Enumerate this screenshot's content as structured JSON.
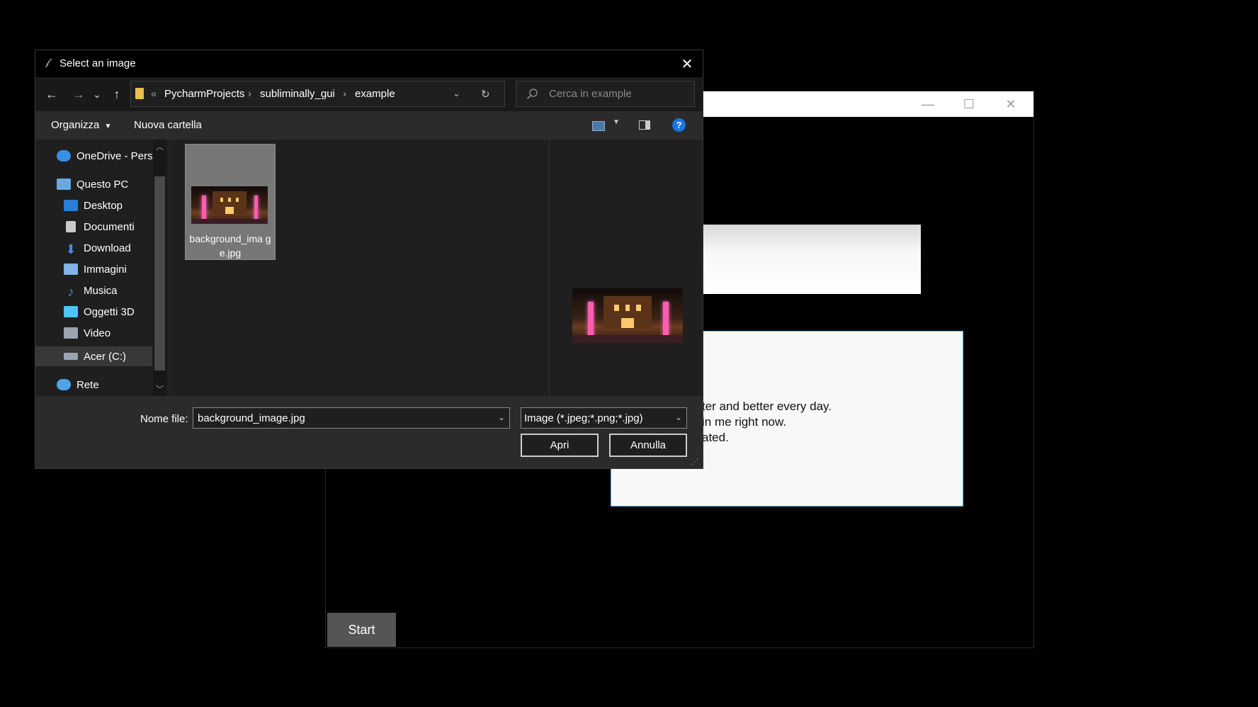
{
  "background_app": {
    "text_lines": [
      "ter and better every day.",
      "in me right now.",
      "ated."
    ],
    "start_label": "Start",
    "caption_buttons": {
      "minimize": "—",
      "maximize": "☐",
      "close": "✕"
    }
  },
  "dialog": {
    "title": "Select an image",
    "close_glyph": "✕",
    "nav": {
      "back": "←",
      "forward": "→",
      "recent": "⌄",
      "up": "↑",
      "refresh": "↻"
    },
    "breadcrumb": {
      "overflow": "«",
      "parts": [
        "PycharmProjects",
        "subliminally_gui",
        "example"
      ],
      "separator": "›"
    },
    "search_placeholder": "Cerca in example",
    "toolbar": {
      "organize": "Organizza",
      "new_folder": "Nuova cartella",
      "help": "?"
    },
    "sidebar": {
      "items": [
        {
          "label": "OneDrive - Perso",
          "icon": "onedrive-icon",
          "color": "#3a8ee6"
        },
        {
          "label": "Questo PC",
          "icon": "computer-icon",
          "color": "#6aa8e0"
        },
        {
          "label": "Desktop",
          "icon": "desktop-icon",
          "color": "#2a7fd4"
        },
        {
          "label": "Documenti",
          "icon": "documents-icon",
          "color": "#c9c9c9"
        },
        {
          "label": "Download",
          "icon": "download-icon",
          "color": "#3a8ee6"
        },
        {
          "label": "Immagini",
          "icon": "pictures-icon",
          "color": "#7fb4e6"
        },
        {
          "label": "Musica",
          "icon": "music-icon",
          "color": "#3a8ee6"
        },
        {
          "label": "Oggetti 3D",
          "icon": "3d-objects-icon",
          "color": "#4fc3f7"
        },
        {
          "label": "Video",
          "icon": "video-icon",
          "color": "#9aa5b1"
        },
        {
          "label": "Acer (C:)",
          "icon": "drive-icon",
          "color": "#9aa5b1"
        },
        {
          "label": "Rete",
          "icon": "network-icon",
          "color": "#4fa3e6"
        }
      ],
      "selected": "Acer (C:)"
    },
    "files": [
      {
        "name": "background_image.jpg",
        "display": "background_ima ge.jpg",
        "selected": true
      }
    ],
    "filename_label": "Nome file:",
    "filename_value": "background_image.jpg",
    "filetype_value": "Image (*.jpeg;*.png;*.jpg)",
    "open_label": "Apri",
    "cancel_label": "Annulla"
  }
}
